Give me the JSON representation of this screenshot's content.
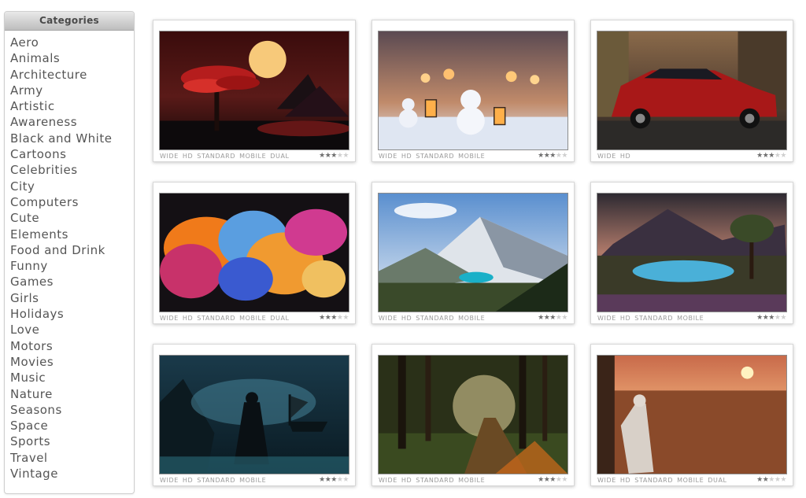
{
  "sidebar": {
    "title": "Categories",
    "items": [
      {
        "label": "Aero"
      },
      {
        "label": "Animals"
      },
      {
        "label": "Architecture"
      },
      {
        "label": "Army"
      },
      {
        "label": "Artistic"
      },
      {
        "label": "Awareness"
      },
      {
        "label": "Black and White"
      },
      {
        "label": "Cartoons"
      },
      {
        "label": "Celebrities"
      },
      {
        "label": "City"
      },
      {
        "label": "Computers"
      },
      {
        "label": "Cute"
      },
      {
        "label": "Elements"
      },
      {
        "label": "Food and Drink"
      },
      {
        "label": "Funny"
      },
      {
        "label": "Games"
      },
      {
        "label": "Girls"
      },
      {
        "label": "Holidays"
      },
      {
        "label": "Love"
      },
      {
        "label": "Motors"
      },
      {
        "label": "Movies"
      },
      {
        "label": "Music"
      },
      {
        "label": "Nature"
      },
      {
        "label": "Seasons"
      },
      {
        "label": "Space"
      },
      {
        "label": "Sports"
      },
      {
        "label": "Travel"
      },
      {
        "label": "Vintage"
      }
    ]
  },
  "wallpapers": [
    {
      "name": "bonsai-tree-moon",
      "tags": [
        "WIDE",
        "HD",
        "STANDARD",
        "MOBILE",
        "DUAL"
      ],
      "rating": 3.5
    },
    {
      "name": "snowmen-lanterns",
      "tags": [
        "WIDE",
        "HD",
        "STANDARD",
        "MOBILE"
      ],
      "rating": 3.5
    },
    {
      "name": "red-muscle-car",
      "tags": [
        "WIDE",
        "HD"
      ],
      "rating": 3
    },
    {
      "name": "colorful-smoke",
      "tags": [
        "WIDE",
        "HD",
        "STANDARD",
        "MOBILE",
        "DUAL"
      ],
      "rating": 3.5
    },
    {
      "name": "mountain-lake",
      "tags": [
        "WIDE",
        "HD",
        "STANDARD",
        "MOBILE"
      ],
      "rating": 3.5
    },
    {
      "name": "fantasy-lake-tree",
      "tags": [
        "WIDE",
        "HD",
        "STANDARD",
        "MOBILE"
      ],
      "rating": 3
    },
    {
      "name": "samurai-ships",
      "tags": [
        "WIDE",
        "HD",
        "STANDARD",
        "MOBILE"
      ],
      "rating": 3
    },
    {
      "name": "forest-path",
      "tags": [
        "WIDE",
        "HD",
        "STANDARD",
        "MOBILE"
      ],
      "rating": 3.5
    },
    {
      "name": "assassin-desert-city",
      "tags": [
        "WIDE",
        "HD",
        "STANDARD",
        "MOBILE",
        "DUAL"
      ],
      "rating": 2.5
    }
  ],
  "colors": {
    "sidebar_text": "#555555",
    "tag_text": "#9a9a9a",
    "star_on": "#6f6f6f",
    "star_off": "#cfcfcf"
  }
}
